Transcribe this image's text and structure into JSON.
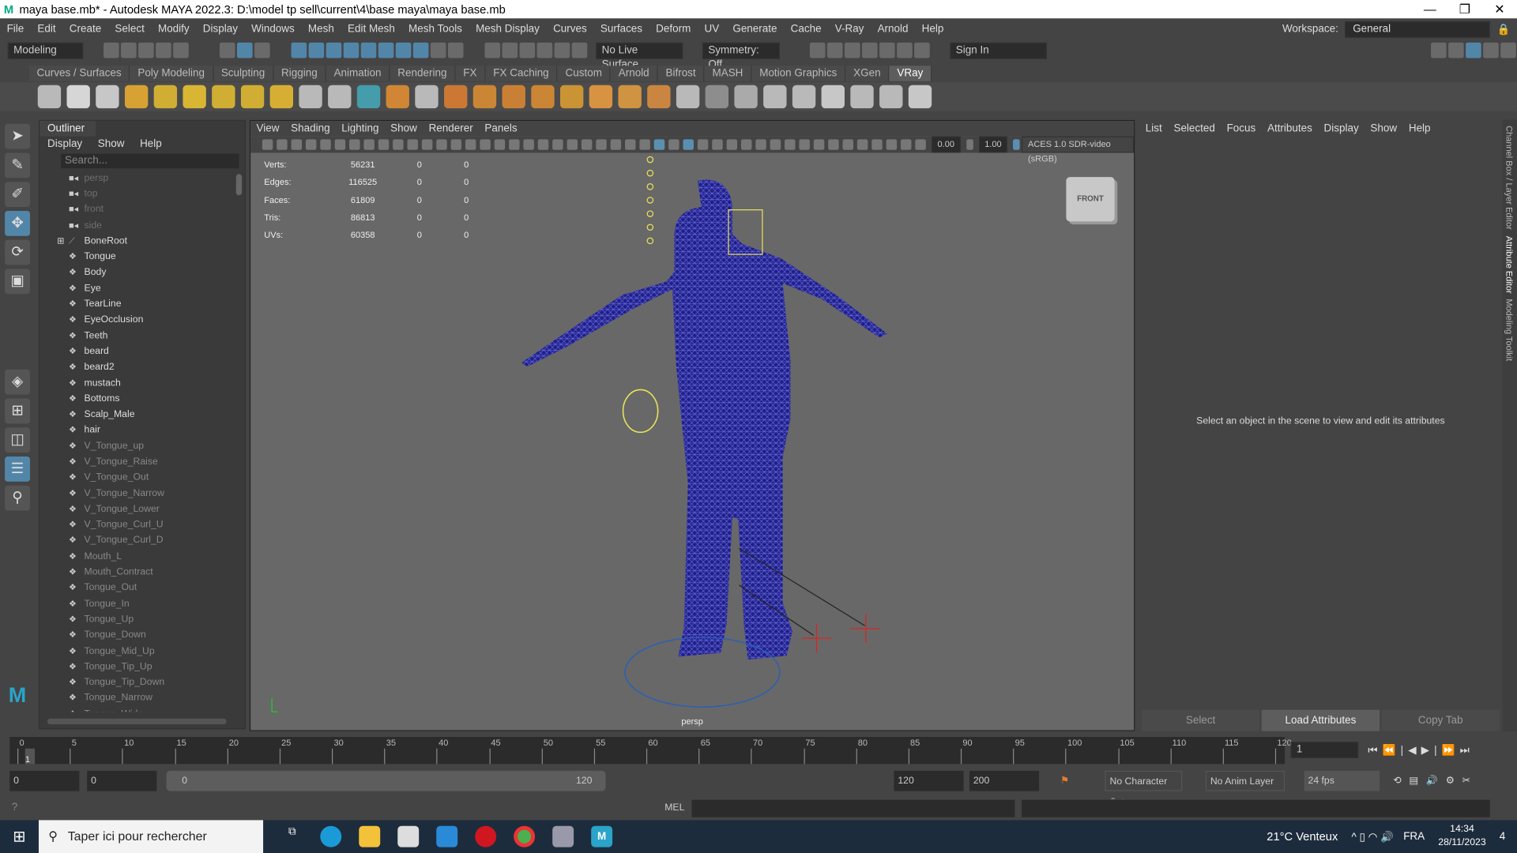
{
  "window": {
    "title": "maya base.mb* - Autodesk MAYA 2022.3: D:\\model tp sell\\current\\4\\base maya\\maya base.mb",
    "minimize": "—",
    "maximize": "❐",
    "close": "✕"
  },
  "menubar": [
    "File",
    "Edit",
    "Create",
    "Select",
    "Modify",
    "Display",
    "Windows",
    "Mesh",
    "Edit Mesh",
    "Mesh Tools",
    "Mesh Display",
    "Curves",
    "Surfaces",
    "Deform",
    "UV",
    "Generate",
    "Cache",
    "V-Ray",
    "Arnold",
    "Help"
  ],
  "statusline": {
    "mode": "Modeling",
    "live_surface": "No Live Surface",
    "symmetry": "Symmetry: Off",
    "sign_in": "Sign In",
    "workspace_label": "Workspace:",
    "workspace": "General"
  },
  "shelf_tabs": [
    "Curves / Surfaces",
    "Poly Modeling",
    "Sculpting",
    "Rigging",
    "Animation",
    "Rendering",
    "FX",
    "FX Caching",
    "Custom",
    "Arnold",
    "Bifrost",
    "MASH",
    "Motion Graphics",
    "XGen",
    "VRay"
  ],
  "shelf_active": "VRay",
  "outliner": {
    "tab": "Outliner",
    "menu": [
      "Display",
      "Show",
      "Help"
    ],
    "search_placeholder": "Search...",
    "items": [
      {
        "name": "persp",
        "type": "camera"
      },
      {
        "name": "top",
        "type": "camera"
      },
      {
        "name": "front",
        "type": "camera"
      },
      {
        "name": "side",
        "type": "camera"
      },
      {
        "name": "BoneRoot",
        "type": "joint",
        "expandable": true
      },
      {
        "name": "Tongue",
        "type": "mesh"
      },
      {
        "name": "Body",
        "type": "mesh"
      },
      {
        "name": "Eye",
        "type": "mesh"
      },
      {
        "name": "TearLine",
        "type": "mesh"
      },
      {
        "name": "EyeOcclusion",
        "type": "mesh"
      },
      {
        "name": "Teeth",
        "type": "mesh"
      },
      {
        "name": "beard",
        "type": "mesh"
      },
      {
        "name": "beard2",
        "type": "mesh"
      },
      {
        "name": "mustach",
        "type": "mesh"
      },
      {
        "name": "Bottoms",
        "type": "mesh"
      },
      {
        "name": "Scalp_Male",
        "type": "mesh"
      },
      {
        "name": "hair",
        "type": "mesh"
      },
      {
        "name": "V_Tongue_up",
        "type": "hidden"
      },
      {
        "name": "V_Tongue_Raise",
        "type": "hidden"
      },
      {
        "name": "V_Tongue_Out",
        "type": "hidden"
      },
      {
        "name": "V_Tongue_Narrow",
        "type": "hidden"
      },
      {
        "name": "V_Tongue_Lower",
        "type": "hidden"
      },
      {
        "name": "V_Tongue_Curl_U",
        "type": "hidden"
      },
      {
        "name": "V_Tongue_Curl_D",
        "type": "hidden"
      },
      {
        "name": "Mouth_L",
        "type": "hidden"
      },
      {
        "name": "Mouth_Contract",
        "type": "hidden"
      },
      {
        "name": "Tongue_Out",
        "type": "hidden"
      },
      {
        "name": "Tongue_In",
        "type": "hidden"
      },
      {
        "name": "Tongue_Up",
        "type": "hidden"
      },
      {
        "name": "Tongue_Down",
        "type": "hidden"
      },
      {
        "name": "Tongue_Mid_Up",
        "type": "hidden"
      },
      {
        "name": "Tongue_Tip_Up",
        "type": "hidden"
      },
      {
        "name": "Tongue_Tip_Down",
        "type": "hidden"
      },
      {
        "name": "Tongue_Narrow",
        "type": "hidden"
      },
      {
        "name": "Tongue_Wide",
        "type": "hidden"
      }
    ]
  },
  "viewport": {
    "menu": [
      "View",
      "Shading",
      "Lighting",
      "Show",
      "Renderer",
      "Panels"
    ],
    "exposure": "0.00",
    "gamma": "1.00",
    "color_space": "ACES 1.0 SDR-video (sRGB)",
    "hud": [
      [
        "Verts:",
        "56231",
        "0",
        "0"
      ],
      [
        "Edges:",
        "116525",
        "0",
        "0"
      ],
      [
        "Faces:",
        "61809",
        "0",
        "0"
      ],
      [
        "Tris:",
        "86813",
        "0",
        "0"
      ],
      [
        "UVs:",
        "60358",
        "0",
        "0"
      ]
    ],
    "viewcube": "FRONT",
    "camera": "persp"
  },
  "attribute_editor": {
    "menu": [
      "List",
      "Selected",
      "Focus",
      "Attributes",
      "Display",
      "Show",
      "Help"
    ],
    "message": "Select an object in the scene to view and edit its attributes",
    "buttons": [
      "Select",
      "Load Attributes",
      "Copy Tab"
    ]
  },
  "side_tabs": [
    "Channel Box / Layer Editor",
    "Attribute Editor",
    "Modeling Toolkit"
  ],
  "timeline": {
    "ticks": [
      "0",
      "5",
      "10",
      "15",
      "20",
      "25",
      "30",
      "35",
      "40",
      "45",
      "50",
      "55",
      "60",
      "65",
      "70",
      "75",
      "80",
      "85",
      "90",
      "95",
      "100",
      "105",
      "110",
      "115",
      "120"
    ],
    "current_frame": "1",
    "frame_field": "1"
  },
  "range": {
    "start": "0",
    "playback_start": "0",
    "slider_start": "0",
    "slider_end": "120",
    "playback_end": "120",
    "end": "200",
    "character_set": "No Character Set",
    "anim_layer": "No Anim Layer",
    "fps": "24 fps"
  },
  "cmd": {
    "help": "?",
    "lang": "MEL"
  },
  "taskbar": {
    "search": "Taper ici pour rechercher",
    "weather": "21°C  Venteux",
    "lang": "FRA",
    "time": "14:34",
    "date": "28/11/2023",
    "notif": "4"
  }
}
